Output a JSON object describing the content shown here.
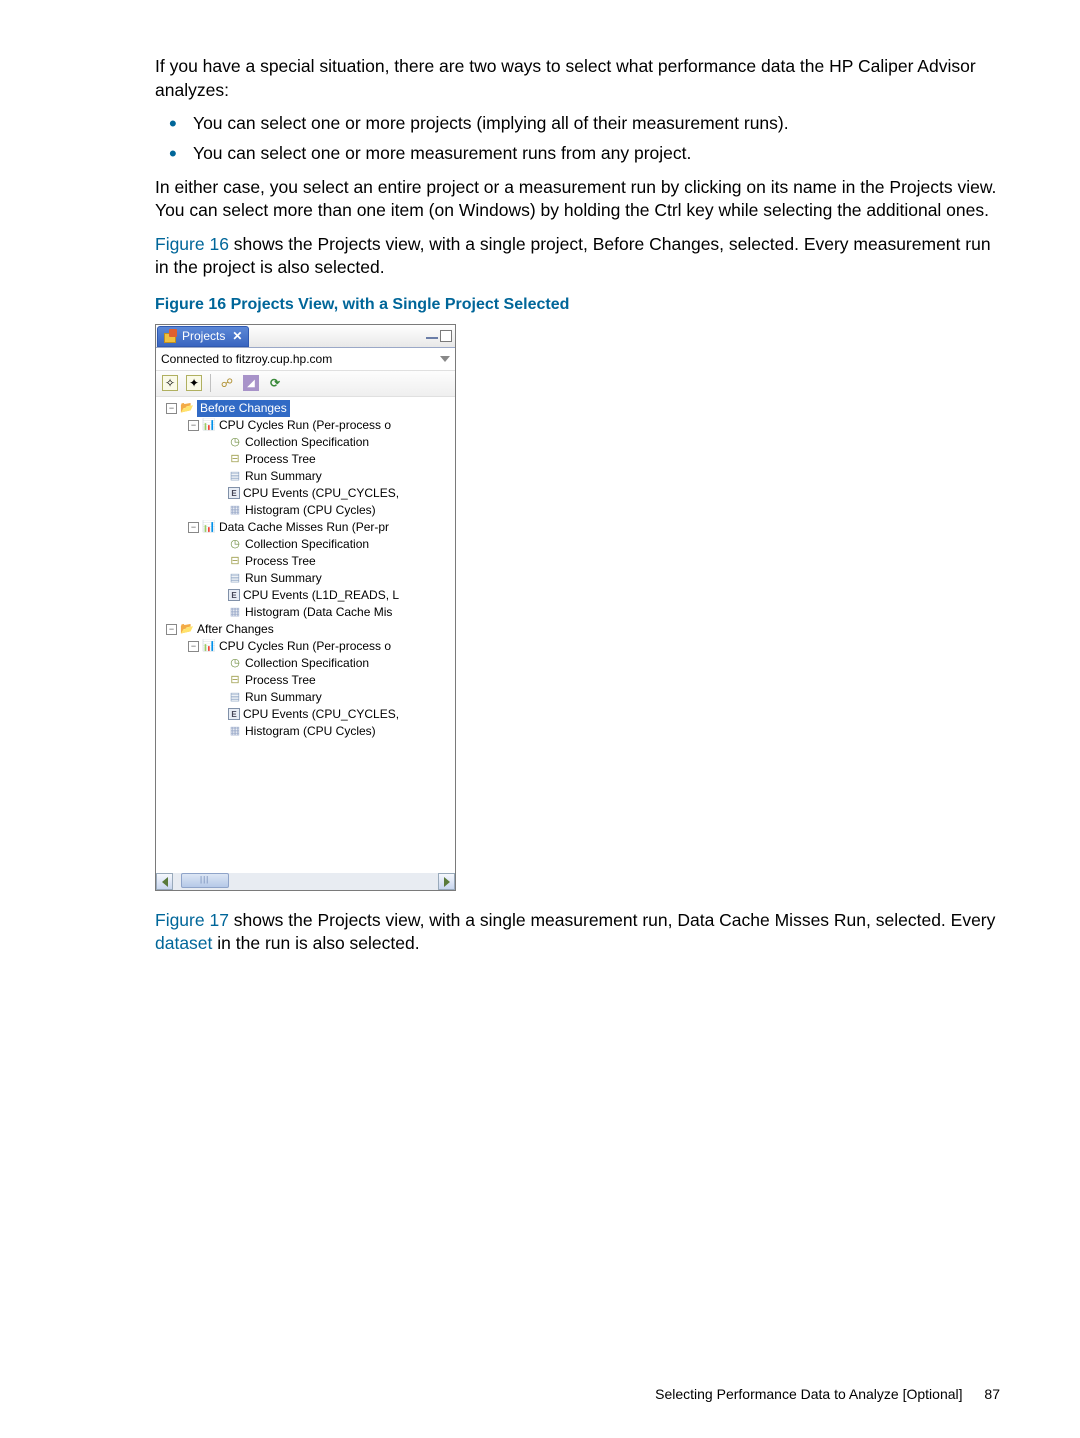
{
  "body": {
    "p1": "If you have a special situation, there are two ways to select what performance data the HP Caliper Advisor analyzes:",
    "bullets": [
      "You can select one or more projects (implying all of their measurement runs).",
      "You can select one or more measurement runs from any project."
    ],
    "p2": "In either case, you select an entire project or a measurement run by clicking on its name in the Projects view. You can select more than one item (on Windows) by holding the Ctrl key while selecting the additional ones.",
    "p3a": "Figure 16",
    "p3b": " shows the Projects view, with a single project, Before Changes, selected. Every measurement run in the project is also selected.",
    "figcap": "Figure 16 Projects View, with a Single Project Selected",
    "p4a": "Figure 17",
    "p4b": " shows the Projects view, with a single measurement run, Data Cache Misses Run, selected. Every ",
    "p4c": "dataset",
    "p4d": " in the run is also selected."
  },
  "panel": {
    "tab": "Projects",
    "connected": "Connected to fitzroy.cup.hp.com",
    "tree": [
      {
        "d": 0,
        "exp": "−",
        "ico": "fold",
        "txt": "Before Changes",
        "sel": true
      },
      {
        "d": 1,
        "exp": "−",
        "ico": "chart",
        "txt": "CPU Cycles Run (Per-process o"
      },
      {
        "d": 2,
        "exp": "",
        "ico": "clock",
        "txt": "Collection Specification"
      },
      {
        "d": 2,
        "exp": "",
        "ico": "tree",
        "txt": "Process Tree"
      },
      {
        "d": 2,
        "exp": "",
        "ico": "page",
        "txt": "Run Summary"
      },
      {
        "d": 2,
        "exp": "",
        "ico": "e",
        "txt": "CPU Events (CPU_CYCLES,"
      },
      {
        "d": 2,
        "exp": "",
        "ico": "grid",
        "txt": "Histogram (CPU Cycles)"
      },
      {
        "d": 1,
        "exp": "−",
        "ico": "chart",
        "txt": "Data Cache Misses Run (Per-pr"
      },
      {
        "d": 2,
        "exp": "",
        "ico": "clock",
        "txt": "Collection Specification"
      },
      {
        "d": 2,
        "exp": "",
        "ico": "tree",
        "txt": "Process Tree"
      },
      {
        "d": 2,
        "exp": "",
        "ico": "page",
        "txt": "Run Summary"
      },
      {
        "d": 2,
        "exp": "",
        "ico": "e",
        "txt": "CPU Events (L1D_READS, L"
      },
      {
        "d": 2,
        "exp": "",
        "ico": "grid",
        "txt": "Histogram (Data Cache Mis"
      },
      {
        "d": 0,
        "exp": "−",
        "ico": "fold",
        "txt": "After Changes"
      },
      {
        "d": 1,
        "exp": "−",
        "ico": "chart",
        "txt": "CPU Cycles Run (Per-process o"
      },
      {
        "d": 2,
        "exp": "",
        "ico": "clock",
        "txt": "Collection Specification"
      },
      {
        "d": 2,
        "exp": "",
        "ico": "tree",
        "txt": "Process Tree"
      },
      {
        "d": 2,
        "exp": "",
        "ico": "page",
        "txt": "Run Summary"
      },
      {
        "d": 2,
        "exp": "",
        "ico": "e",
        "txt": "CPU Events (CPU_CYCLES,"
      },
      {
        "d": 2,
        "exp": "",
        "ico": "grid",
        "txt": "Histogram (CPU Cycles)"
      }
    ]
  },
  "footer": {
    "text": "Selecting Performance Data to Analyze [Optional]",
    "page": "87"
  }
}
